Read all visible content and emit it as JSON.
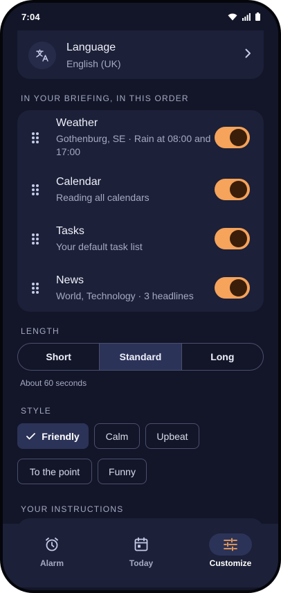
{
  "status_bar": {
    "time": "7:04"
  },
  "language": {
    "title": "Language",
    "value": "English (UK)"
  },
  "briefing": {
    "section_label": "IN YOUR BRIEFING, IN THIS ORDER",
    "items": [
      {
        "title": "Weather",
        "subtitle": "Gothenburg, SE · Rain at 08:00 and 17:00",
        "enabled": true
      },
      {
        "title": "Calendar",
        "subtitle": "Reading all calendars",
        "enabled": true
      },
      {
        "title": "Tasks",
        "subtitle": "Your default task list",
        "enabled": true
      },
      {
        "title": "News",
        "subtitle": "World, Technology · 3 headlines",
        "enabled": true
      }
    ]
  },
  "length": {
    "section_label": "LENGTH",
    "options": [
      "Short",
      "Standard",
      "Long"
    ],
    "selected": "Standard",
    "helper": "About 60 seconds"
  },
  "style": {
    "section_label": "STYLE",
    "options": [
      "Friendly",
      "Calm",
      "Upbeat",
      "To the point",
      "Funny"
    ],
    "selected": "Friendly"
  },
  "instructions": {
    "section_label": "YOUR INSTRUCTIONS"
  },
  "bottom_nav": {
    "items": [
      {
        "label": "Alarm",
        "icon": "alarm-clock-icon"
      },
      {
        "label": "Today",
        "icon": "calendar-icon"
      },
      {
        "label": "Customize",
        "icon": "sliders-icon"
      }
    ],
    "active": "Customize"
  },
  "colors": {
    "accent": "#f6a35b",
    "background": "#131629",
    "card": "#1c2038",
    "selected": "#2c3358"
  }
}
